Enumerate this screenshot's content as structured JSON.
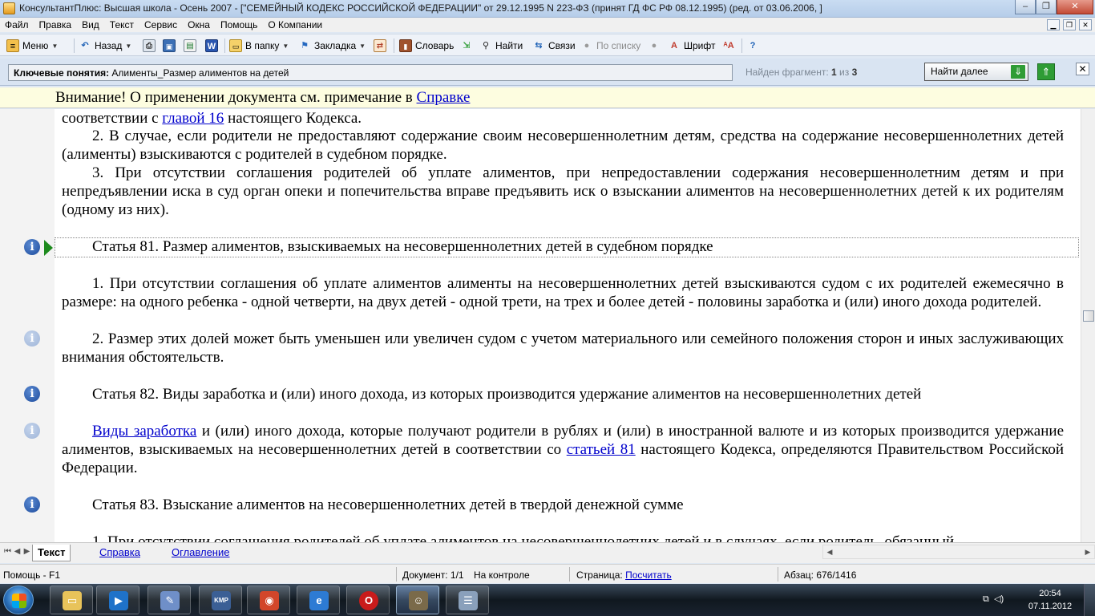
{
  "window": {
    "title": "КонсультантПлюс: Высшая школа - Осень 2007 - [\"СЕМЕЙНЫЙ КОДЕКС РОССИЙСКОЙ ФЕДЕРАЦИИ\" от 29.12.1995 N 223-ФЗ (принят ГД ФС РФ 08.12.1995) (ред. от 03.06.2006, ]",
    "min": "–",
    "max": "❐",
    "close": "✕"
  },
  "menu": [
    "Файл",
    "Правка",
    "Вид",
    "Текст",
    "Сервис",
    "Окна",
    "Помощь",
    "О Компании"
  ],
  "toolbar": {
    "menu_label": "Меню",
    "back_label": "Назад",
    "folder_label": "В папку",
    "bookmark_label": "Закладка",
    "dictionary_label": "Словарь",
    "find_label": "Найти",
    "links_label": "Связи",
    "bylist_label": "По списку",
    "font_label": "Шрифт"
  },
  "search": {
    "prefix": "Ключевые понятия:",
    "query": " Алименты_Размер алиментов на детей",
    "found_prefix": "Найден фрагмент: ",
    "found_current": "1",
    "found_middle": " из ",
    "found_total": "3",
    "find_next_label": "Найти далее",
    "close": "✕"
  },
  "attention": {
    "text": "Внимание! О применении документа см. примечание в ",
    "link": "Справке"
  },
  "document": {
    "p0_pre": "соответствии с ",
    "p0_link": "главой 16",
    "p0_post": " настоящего Кодекса.",
    "p1": "2. В случае, если родители не предоставляют содержание своим несовершеннолетним детям, средства на содержание несовершеннолетних детей (алименты) взыскиваются с родителей в судебном порядке.",
    "p2": "3. При отсутствии соглашения родителей об уплате алиментов, при непредоставлении содержания несовершеннолетним детям и при непредъявлении иска в суд орган опеки и попечительства вправе предъявить иск о взыскании алиментов на несовершеннолетних детей к их родителям (одному из них).",
    "h81": "Статья 81. Размер алиментов, взыскиваемых на несовершеннолетних детей в судебном порядке",
    "p81_1": "1. При отсутствии соглашения об уплате алиментов алименты на несовершеннолетних детей взыскиваются судом с их родителей ежемесячно в размере: на одного ребенка - одной четверти, на двух детей - одной трети, на трех и более детей - половины заработка и (или) иного дохода родителей.",
    "p81_2": "2. Размер этих долей может быть уменьшен или увеличен судом с учетом материального или семейного положения сторон и иных заслуживающих внимания обстоятельств.",
    "h82": "Статья 82. Виды заработка и (или) иного дохода, из которых производится удержание алиментов на несовершеннолетних детей",
    "p82_link1": "Виды заработка",
    "p82_mid": " и (или) иного дохода, которые получают родители в рублях и (или) в иностранной валюте и из которых производится удержание алиментов, взыскиваемых на несовершеннолетних детей в соответствии со ",
    "p82_link2": "статьей 81",
    "p82_post": " настоящего Кодекса, определяются Правительством Российской Федерации.",
    "h83": "Статья 83. Взыскание алиментов на несовершеннолетних детей в твердой денежной сумме",
    "p83_1": "1. При отсутствии соглашения родителей об уплате алиментов на несовершеннолетних детей и в случаях, если родитель, обязанный"
  },
  "tabs": {
    "text": "Текст",
    "help": "Справка",
    "contents": "Оглавление"
  },
  "status": {
    "help": "Помощь - F1",
    "document": "Документ: 1/1",
    "monitored": "На контроле",
    "page_label": "Страница: ",
    "page_link": "Посчитать",
    "paragraph": "Абзац: 676/1416"
  },
  "taskbar": {
    "time": "20:54",
    "date": "07.11.2012"
  },
  "colors": {
    "accent_green": "#2f9c35",
    "link_blue": "#0000cc",
    "info_blue": "#1d4b9c"
  }
}
